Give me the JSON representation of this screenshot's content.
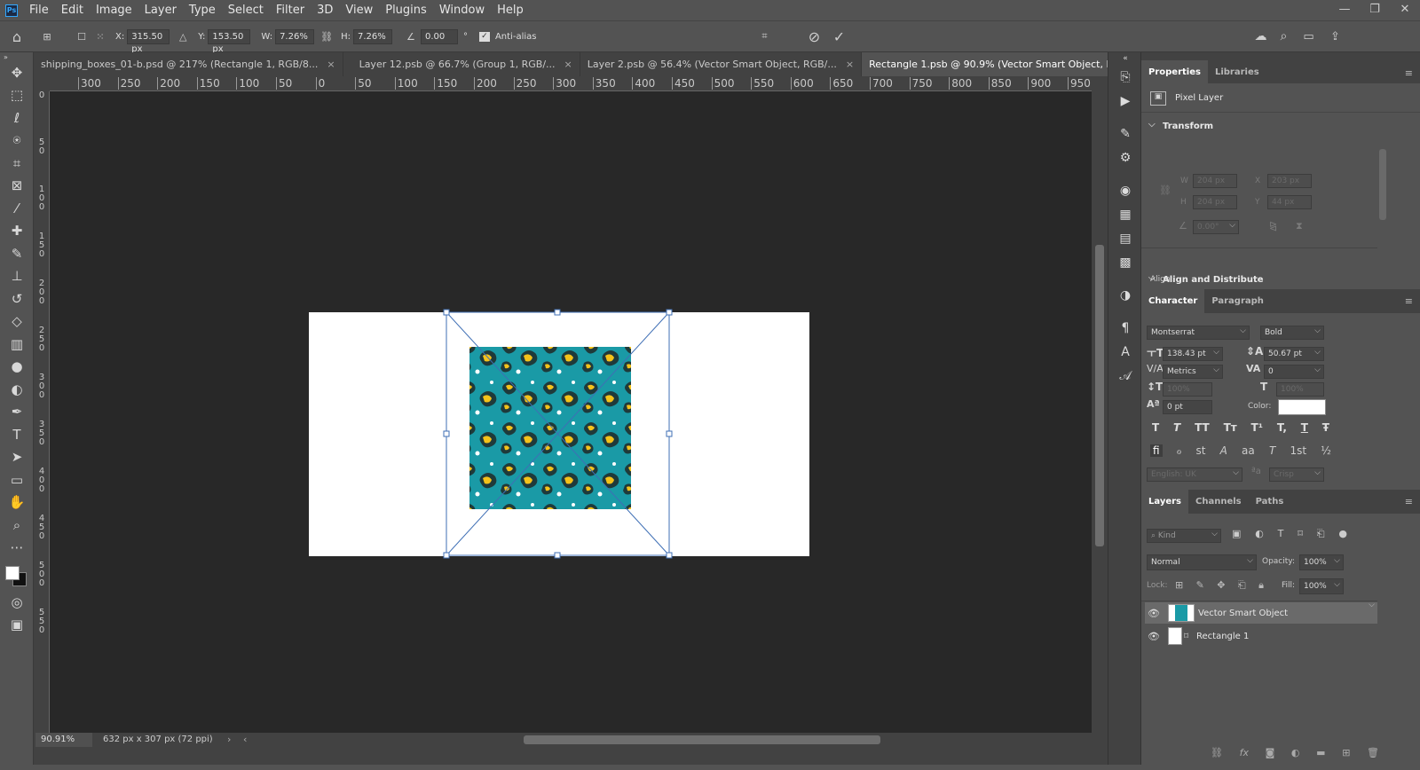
{
  "app": {
    "logo": "Ps"
  },
  "menu": [
    "File",
    "Edit",
    "Image",
    "Layer",
    "Type",
    "Select",
    "Filter",
    "3D",
    "View",
    "Plugins",
    "Window",
    "Help"
  ],
  "window_controls": {
    "minimize": "—",
    "restore": "❐",
    "close": "✕"
  },
  "options": {
    "x_label": "X:",
    "x_value": "315.50 px",
    "y_label": "Y:",
    "y_value": "153.50 px",
    "w_label": "W:",
    "w_value": "7.26%",
    "h_label": "H:",
    "h_value": "7.26%",
    "angle_value": "0.00",
    "angle_unit": "°",
    "antialias_label": "Anti-alias"
  },
  "tabs": [
    {
      "label": "shipping_boxes_01-b.psd @ 217% (Rectangle 1, RGB/8...",
      "active": false
    },
    {
      "label": "Layer 12.psb @ 66.7% (Group 1, RGB/...",
      "active": false
    },
    {
      "label": "Layer 2.psb @ 56.4% (Vector Smart Object, RGB/...",
      "active": false
    },
    {
      "label": "Rectangle 1.psb @ 90.9% (Vector Smart Object, RGB/8#)",
      "active": true
    }
  ],
  "ruler_h": [
    "300",
    "250",
    "200",
    "150",
    "100",
    "50",
    "0",
    "50",
    "100",
    "150",
    "200",
    "250",
    "300",
    "350",
    "400",
    "450",
    "500",
    "550",
    "600",
    "650",
    "700",
    "750",
    "800",
    "850",
    "900",
    "950"
  ],
  "ruler_v": [
    "0",
    "5\n0",
    "1\n0\n0",
    "1\n5\n0",
    "2\n0\n0",
    "2\n5\n0",
    "3\n0\n0",
    "3\n5\n0",
    "4\n0\n0",
    "4\n5\n0",
    "5\n0\n0",
    "5\n5\n0"
  ],
  "status": {
    "zoom": "90.91%",
    "doc_size": "632 px x 307 px (72 ppi)"
  },
  "properties": {
    "tabs": [
      "Properties",
      "Libraries"
    ],
    "layer_type": "Pixel Layer",
    "transform_title": "Transform",
    "w_label": "W",
    "w_value": "204 px",
    "h_label": "H",
    "h_value": "204 px",
    "x_label": "X",
    "x_value": "203 px",
    "y_label": "Y",
    "y_value": "44 px",
    "angle_value": "0.00°",
    "align_title": "Align and Distribute",
    "align_label": "Align:"
  },
  "character": {
    "tabs": [
      "Character",
      "Paragraph"
    ],
    "font_family": "Montserrat",
    "font_style": "Bold",
    "font_size": "138.43 pt",
    "leading": "50.67 pt",
    "kerning": "Metrics",
    "tracking": "0",
    "vscale": "100%",
    "hscale": "100%",
    "baseline": "0 pt",
    "color_label": "Color:",
    "language": "English: UK",
    "antialias": "Crisp",
    "style_buttons": [
      "T",
      "T",
      "TT",
      "Tт",
      "T¹",
      "T,",
      "T",
      "Ŧ"
    ],
    "ot_buttons": [
      "fi",
      "ℴ",
      "st",
      "A",
      "aa",
      "T",
      "1st",
      "½"
    ]
  },
  "layers": {
    "tabs": [
      "Layers",
      "Channels",
      "Paths"
    ],
    "filter_placeholder": "Kind",
    "blend_mode": "Normal",
    "opacity_label": "Opacity:",
    "opacity_value": "100%",
    "lock_label": "Lock:",
    "fill_label": "Fill:",
    "fill_value": "100%",
    "items": [
      {
        "name": "Vector Smart Object",
        "selected": true
      },
      {
        "name": "Rectangle 1",
        "selected": false
      }
    ]
  },
  "colors": {
    "accent": "#31a8ff",
    "pattern_teal": "#1a9aa6",
    "pattern_yellow": "#f4c21a",
    "pattern_dark": "#1f3a3a"
  }
}
